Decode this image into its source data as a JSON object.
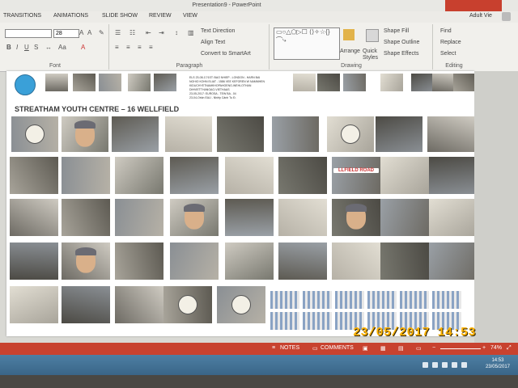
{
  "window": {
    "title": "Presentation9 - PowerPoint"
  },
  "tabs": [
    {
      "label": "TRANSITIONS"
    },
    {
      "label": "ANIMATIONS"
    },
    {
      "label": "SLIDE SHOW"
    },
    {
      "label": "REVIEW"
    },
    {
      "label": "VIEW"
    }
  ],
  "account": {
    "name": "Adult Vie"
  },
  "ribbon": {
    "font_size": "28",
    "paragraph": {
      "text_direction": "Text Direction",
      "align_text": "Align Text",
      "smartart": "Convert to SmartArt"
    },
    "drawing": {
      "arrange": "Arrange",
      "quick_styles": "Quick Styles",
      "shape_fill": "Shape Fill",
      "shape_outline": "Shape Outline",
      "shape_effects": "Shape Effects"
    },
    "editing": {
      "find": "Find",
      "replace": "Replace",
      "select": "Select"
    },
    "group_labels": {
      "font": "Font",
      "paragraph": "Paragraph",
      "drawing": "Drawing",
      "editing": "Editing"
    }
  },
  "slide": {
    "title": "STREATHAM YOUTH CENTRE – 16 WELLFIELD",
    "caption_lines": [
      "ELS 23-08-17/1ST: BAO NHIEP - LONDON - HARN BAI",
      "NGHIO KOHN ELIAT - 1586 VEE KEFOREN W NAMMHEN",
      "KIDUCHYETNAMKHOPAHOENG-WEHLOTHAN",
      "DIHVIETTHANOAO-VIETHAAS",
      "23-05-2017: EUROSA - TEW BA - 04"
    ],
    "caption_red": "23-04-Orkin EAU - Nhiếp Cảnh Tu Đ.",
    "street_sign": "LLFIELD ROAD",
    "photo_colors": [
      "#6d6a63",
      "#a8a49a",
      "#8a8f94",
      "#cfcbc2",
      "#5d5a52",
      "#b6b1a6",
      "#78786f",
      "#9aa0a6",
      "#e2ded3",
      "#4c4a44"
    ]
  },
  "stamp": {
    "date": "23/05/2017",
    "time": "14:53"
  },
  "statusbar": {
    "notes": "NOTES",
    "comments": "COMMENTS",
    "zoom": "74%"
  },
  "taskbar": {
    "time": "14:53",
    "date": "23/05/2017"
  },
  "icons": [
    "logo-icon",
    "notes-icon",
    "comments-icon",
    "normal-view-icon",
    "slide-sorter-icon",
    "reading-view-icon",
    "slideshow-icon",
    "fit-icon"
  ]
}
